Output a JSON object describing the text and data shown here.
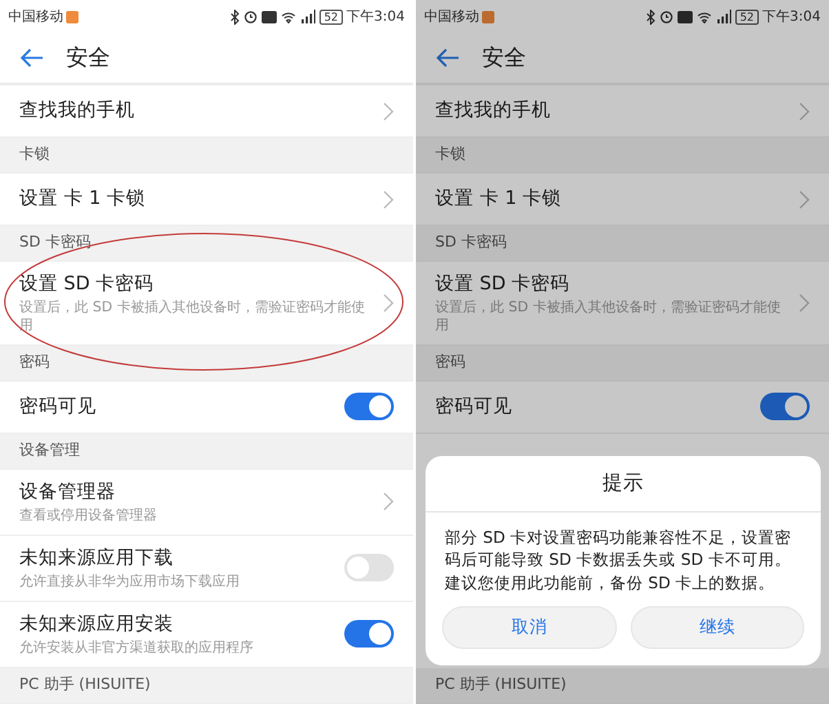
{
  "screens": [
    {
      "status_bar": {
        "carrier": "中国移动",
        "battery": "52",
        "time": "下午3:04"
      },
      "title": "安全",
      "items": [
        {
          "kind": "link",
          "title": "查找我的手机"
        },
        {
          "kind": "section",
          "title": "卡锁"
        },
        {
          "kind": "link",
          "title": "设置 卡 1 卡锁"
        },
        {
          "kind": "section",
          "title": "SD 卡密码"
        },
        {
          "kind": "link",
          "title": "设置 SD 卡密码",
          "subtitle": "设置后，此 SD 卡被插入其他设备时，需验证密码才能使用",
          "highlighted": true
        },
        {
          "kind": "section",
          "title": "密码"
        },
        {
          "kind": "toggle",
          "title": "密码可见",
          "on": true
        },
        {
          "kind": "section",
          "title": "设备管理"
        },
        {
          "kind": "link",
          "title": "设备管理器",
          "subtitle": "查看或停用设备管理器"
        },
        {
          "kind": "toggle",
          "title": "未知来源应用下载",
          "subtitle": "允许直接从非华为应用市场下载应用",
          "on": false
        },
        {
          "kind": "toggle",
          "title": "未知来源应用安装",
          "subtitle": "允许安装从非官方渠道获取的应用程序",
          "on": true
        },
        {
          "kind": "section",
          "title": "PC 助手 (HISUITE)"
        }
      ]
    },
    {
      "status_bar": {
        "carrier": "中国移动",
        "battery": "52",
        "time": "下午3:04"
      },
      "title": "安全",
      "items": [
        {
          "kind": "link",
          "title": "查找我的手机"
        },
        {
          "kind": "section",
          "title": "卡锁"
        },
        {
          "kind": "link",
          "title": "设置 卡 1 卡锁"
        },
        {
          "kind": "section",
          "title": "SD 卡密码"
        },
        {
          "kind": "link",
          "title": "设置 SD 卡密码",
          "subtitle": "设置后，此 SD 卡被插入其他设备时，需验证密码才能使用"
        },
        {
          "kind": "section",
          "title": "密码"
        },
        {
          "kind": "toggle",
          "title": "密码可见",
          "on": true
        },
        {
          "kind": "section",
          "title": "PC 助手 (HISUITE)"
        }
      ],
      "dialog": {
        "title": "提示",
        "message": "部分 SD 卡对设置密码功能兼容性不足，设置密码后可能导致 SD 卡数据丢失或 SD 卡不可用。建议您使用此功能前，备份 SD 卡上的数据。",
        "buttons": [
          {
            "label": "取消"
          },
          {
            "label": "继续"
          }
        ]
      }
    }
  ]
}
